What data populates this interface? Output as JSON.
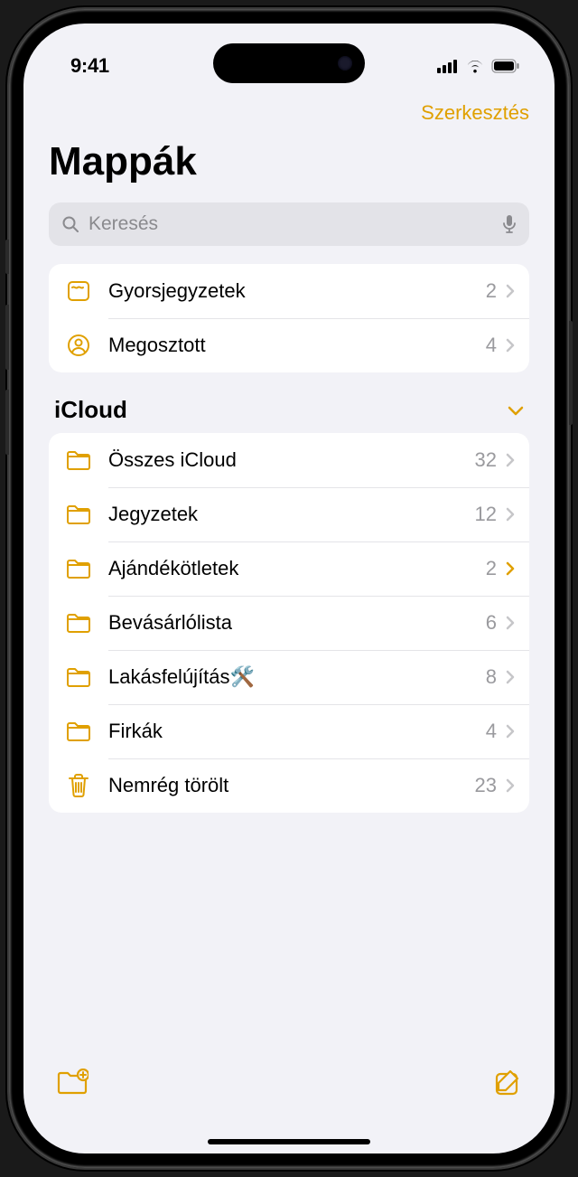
{
  "status": {
    "time": "9:41"
  },
  "nav": {
    "edit": "Szerkesztés"
  },
  "title": "Mappák",
  "search": {
    "placeholder": "Keresés"
  },
  "top_folders": [
    {
      "icon": "quicknote",
      "label": "Gyorsjegyzetek",
      "count": "2"
    },
    {
      "icon": "shared",
      "label": "Megosztott",
      "count": "4"
    }
  ],
  "sections": [
    {
      "title": "iCloud",
      "items": [
        {
          "icon": "folder",
          "label": "Összes iCloud",
          "count": "32"
        },
        {
          "icon": "folder",
          "label": "Jegyzetek",
          "count": "12"
        },
        {
          "icon": "folder",
          "label": "Ajándékötletek",
          "count": "2",
          "accent": true
        },
        {
          "icon": "folder",
          "label": "Bevásárlólista",
          "count": "6"
        },
        {
          "icon": "folder",
          "label": "Lakásfelújítás🛠️",
          "count": "8"
        },
        {
          "icon": "folder",
          "label": "Firkák",
          "count": "4"
        },
        {
          "icon": "trash",
          "label": "Nemrég törölt",
          "count": "23"
        }
      ]
    }
  ]
}
